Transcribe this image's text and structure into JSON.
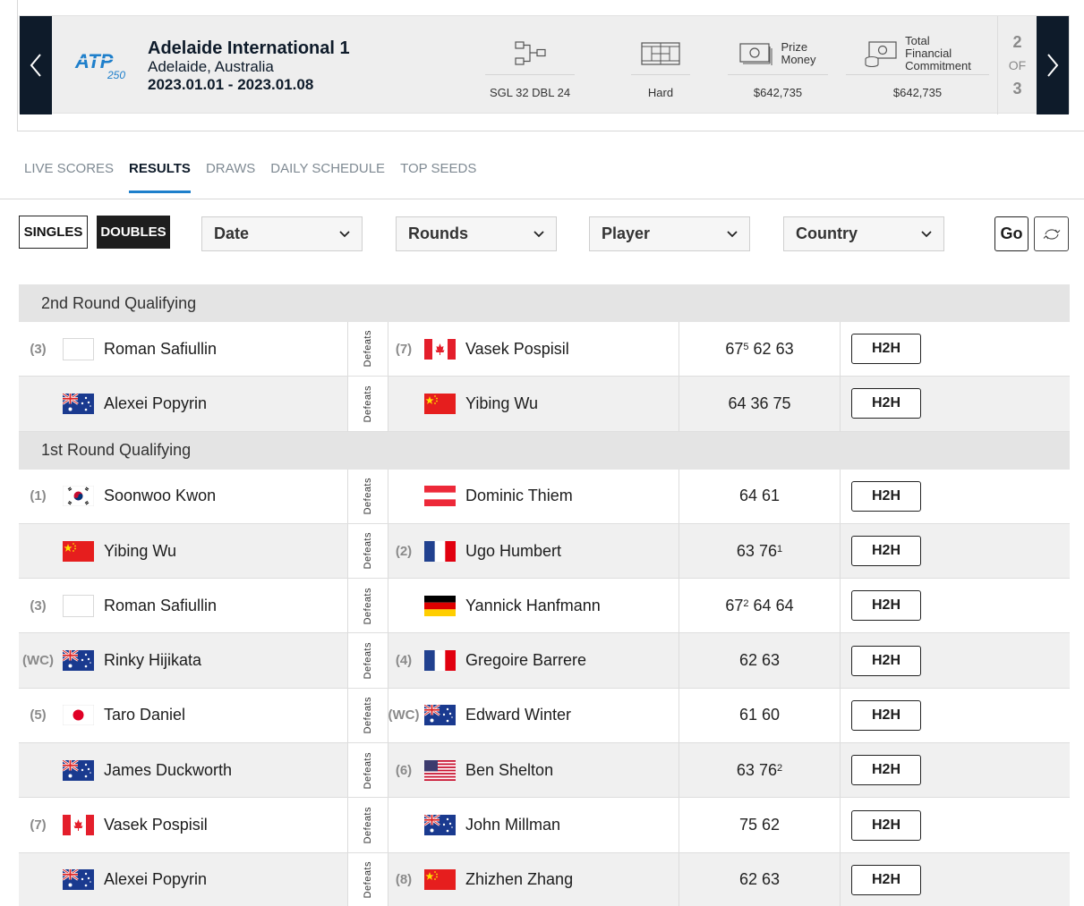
{
  "tournament": {
    "name": "Adelaide International 1",
    "location": "Adelaide, Australia",
    "dates": "2023.01.01 - 2023.01.08",
    "logo_text": "ATP",
    "logo_sub": "250",
    "draw": "SGL 32 DBL 24",
    "surface": "Hard",
    "prize_label_1": "Prize",
    "prize_label_2": "Money",
    "prize_money": "$642,735",
    "tfc_label_1": "Total",
    "tfc_label_2": "Financial",
    "tfc_label_3": "Commitment",
    "tfc": "$642,735",
    "pager": {
      "current": "2",
      "of": "OF",
      "total": "3"
    }
  },
  "tabs": [
    "LIVE SCORES",
    "RESULTS",
    "DRAWS",
    "DAILY SCHEDULE",
    "TOP SEEDS"
  ],
  "active_tab": "RESULTS",
  "filters": {
    "singles": "SINGLES",
    "doubles": "DOUBLES",
    "date": "Date",
    "rounds": "Rounds",
    "player": "Player",
    "country": "Country",
    "go": "Go"
  },
  "colors": {
    "navy": "#0e1b2a",
    "accent": "#1e7fcb",
    "row_alt": "#f0f0f0"
  },
  "rounds": [
    {
      "title": "2nd Round Qualifying",
      "matches": [
        {
          "s1": "(3)",
          "f1": "blank",
          "n1": "Roman Safiullin",
          "s2": "(7)",
          "f2": "can",
          "n2": "Vasek Pospisil",
          "score": [
            [
              "67",
              "5"
            ],
            [
              "62",
              ""
            ],
            [
              "63",
              ""
            ]
          ],
          "h2h": "H2H"
        },
        {
          "s1": "",
          "f1": "aus",
          "n1": "Alexei Popyrin",
          "s2": "",
          "f2": "chn",
          "n2": "Yibing Wu",
          "score": [
            [
              "64",
              ""
            ],
            [
              "36",
              ""
            ],
            [
              "75",
              ""
            ]
          ],
          "h2h": "H2H"
        }
      ]
    },
    {
      "title": "1st Round Qualifying",
      "matches": [
        {
          "s1": "(1)",
          "f1": "kor",
          "n1": "Soonwoo Kwon",
          "s2": "",
          "f2": "aut",
          "n2": "Dominic Thiem",
          "score": [
            [
              "64",
              ""
            ],
            [
              "61",
              ""
            ]
          ],
          "h2h": "H2H"
        },
        {
          "s1": "",
          "f1": "chn",
          "n1": "Yibing Wu",
          "s2": "(2)",
          "f2": "fra",
          "n2": "Ugo Humbert",
          "score": [
            [
              "63",
              ""
            ],
            [
              "76",
              "1"
            ]
          ],
          "h2h": "H2H"
        },
        {
          "s1": "(3)",
          "f1": "blank",
          "n1": "Roman Safiullin",
          "s2": "",
          "f2": "ger",
          "n2": "Yannick Hanfmann",
          "score": [
            [
              "67",
              "2"
            ],
            [
              "64",
              ""
            ],
            [
              "64",
              ""
            ]
          ],
          "h2h": "H2H"
        },
        {
          "s1": "(WC)",
          "f1": "aus",
          "n1": "Rinky Hijikata",
          "s2": "(4)",
          "f2": "fra",
          "n2": "Gregoire Barrere",
          "score": [
            [
              "62",
              ""
            ],
            [
              "63",
              ""
            ]
          ],
          "h2h": "H2H"
        },
        {
          "s1": "(5)",
          "f1": "jpn",
          "n1": "Taro Daniel",
          "s2": "(WC)",
          "f2": "aus",
          "n2": "Edward Winter",
          "score": [
            [
              "61",
              ""
            ],
            [
              "60",
              ""
            ]
          ],
          "h2h": "H2H"
        },
        {
          "s1": "",
          "f1": "aus",
          "n1": "James Duckworth",
          "s2": "(6)",
          "f2": "usa",
          "n2": "Ben Shelton",
          "score": [
            [
              "63",
              ""
            ],
            [
              "76",
              "2"
            ]
          ],
          "h2h": "H2H"
        },
        {
          "s1": "(7)",
          "f1": "can",
          "n1": "Vasek Pospisil",
          "s2": "",
          "f2": "aus",
          "n2": "John Millman",
          "score": [
            [
              "75",
              ""
            ],
            [
              "62",
              ""
            ]
          ],
          "h2h": "H2H"
        },
        {
          "s1": "",
          "f1": "aus",
          "n1": "Alexei Popyrin",
          "s2": "(8)",
          "f2": "chn",
          "n2": "Zhizhen Zhang",
          "score": [
            [
              "62",
              ""
            ],
            [
              "63",
              ""
            ]
          ],
          "h2h": "H2H"
        }
      ]
    }
  ],
  "defeats_label": "Defeats"
}
